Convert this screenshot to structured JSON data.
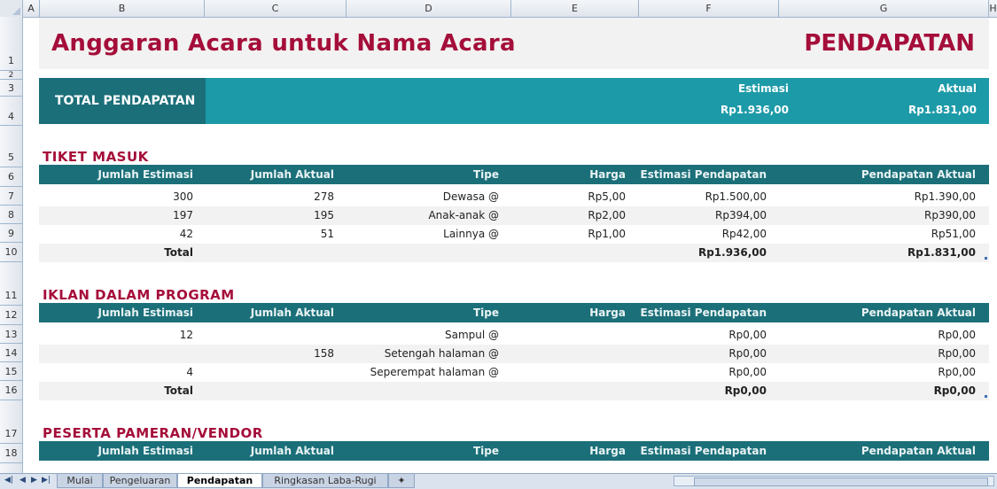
{
  "columns": [
    "A",
    "B",
    "C",
    "D",
    "E",
    "F",
    "G",
    "H"
  ],
  "rows": [
    "1",
    "2",
    "3",
    "4",
    "5",
    "6",
    "7",
    "8",
    "9",
    "10",
    "11",
    "12",
    "13",
    "14",
    "15",
    "16",
    "17",
    "18"
  ],
  "title": "Anggaran Acara untuk Nama Acara",
  "page_label": "PENDAPATAN",
  "total": {
    "label": "TOTAL PENDAPATAN",
    "est_label": "Estimasi",
    "act_label": "Aktual",
    "est_value": "Rp1.936,00",
    "act_value": "Rp1.831,00"
  },
  "headers": [
    "Jumlah Estimasi",
    "Jumlah Aktual",
    "Tipe",
    "Harga",
    "Estimasi Pendapatan",
    "Pendapatan Aktual"
  ],
  "sections": [
    {
      "title": "TIKET MASUK",
      "rows": [
        [
          "300",
          "278",
          "Dewasa @",
          "Rp5,00",
          "Rp1.500,00",
          "Rp1.390,00"
        ],
        [
          "197",
          "195",
          "Anak-anak @",
          "Rp2,00",
          "Rp394,00",
          "Rp390,00"
        ],
        [
          "42",
          "51",
          "Lainnya @",
          "Rp1,00",
          "Rp42,00",
          "Rp51,00"
        ],
        [
          "Total",
          "",
          "",
          "",
          "Rp1.936,00",
          "Rp1.831,00"
        ]
      ]
    },
    {
      "title": "IKLAN DALAM PROGRAM",
      "rows": [
        [
          "12",
          "",
          "Sampul @",
          "",
          "Rp0,00",
          "Rp0,00"
        ],
        [
          "",
          "158",
          "Setengah halaman @",
          "",
          "Rp0,00",
          "Rp0,00"
        ],
        [
          "4",
          "",
          "Seperempat halaman @",
          "",
          "Rp0,00",
          "Rp0,00"
        ],
        [
          "Total",
          "",
          "",
          "",
          "Rp0,00",
          "Rp0,00"
        ]
      ]
    },
    {
      "title": "PESERTA PAMERAN/VENDOR",
      "rows": []
    }
  ],
  "sheet_tabs": [
    "Mulai",
    "Pengeluaran",
    "Pendapatan",
    "Ringkasan Laba-Rugi"
  ],
  "active_tab": "Pendapatan",
  "colors": {
    "accent": "#a50e3a",
    "teal_dark": "#1b6f79",
    "teal": "#1d9aa8"
  }
}
